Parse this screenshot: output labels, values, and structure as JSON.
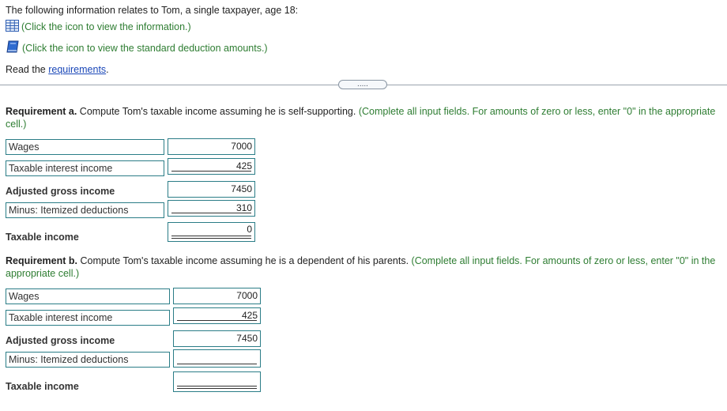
{
  "intro": {
    "text": "The following information relates to Tom, a single taxpayer, age 18:",
    "info_link": "(Click the icon to view the information.)",
    "deduction_link": "(Click the icon to view the standard deduction amounts.)",
    "read_prefix": "Read the ",
    "requirements_link": "requirements",
    "read_suffix": "."
  },
  "expander_label": ".....",
  "colors": {
    "instruction_green": "#2e7d32",
    "link_blue": "#1a47b8",
    "field_border": "#2b7d87"
  },
  "icons": {
    "info": "table-grid-icon",
    "deduction": "book-icon"
  },
  "requirement_a": {
    "heading": "Requirement a.",
    "question": " Compute Tom's taxable income assuming he is self-supporting.",
    "instruction": " (Complete all input fields. For amounts of zero or less, enter \"0\" in the appropriate cell.)",
    "rows": {
      "wages": {
        "label": "Wages",
        "value": "7000"
      },
      "interest": {
        "label": "Taxable interest income",
        "value": "425"
      },
      "agi": {
        "label": "Adjusted gross income",
        "value": "7450"
      },
      "itemized": {
        "label": "Minus: Itemized deductions",
        "value": "310"
      },
      "taxable": {
        "label": "Taxable income",
        "value": "0"
      }
    }
  },
  "requirement_b": {
    "heading": "Requirement b.",
    "question": " Compute Tom's taxable income assuming he is a dependent of his parents.",
    "instruction": " (Complete all input fields. For amounts of zero or less, enter \"0\" in the appropriate cell.)",
    "rows": {
      "wages": {
        "label": "Wages",
        "value": "7000"
      },
      "interest": {
        "label": "Taxable interest income",
        "value": "425"
      },
      "agi": {
        "label": "Adjusted gross income",
        "value": "7450"
      },
      "itemized": {
        "label": "Minus: Itemized deductions",
        "value": ""
      },
      "taxable": {
        "label": "Taxable income",
        "value": ""
      }
    }
  }
}
